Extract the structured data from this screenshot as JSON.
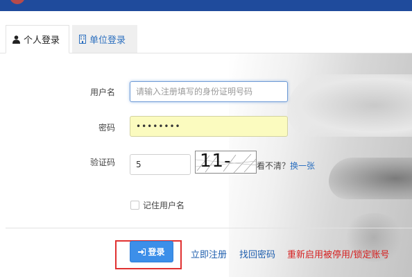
{
  "tabs": {
    "personal_label": "个人登录",
    "unit_label": "单位登录"
  },
  "form": {
    "username_label": "用户名",
    "username_placeholder": "请输入注册填写的身份证明号码",
    "password_label": "密码",
    "password_value": "••••••••",
    "captcha_label": "验证码",
    "captcha_value": "5",
    "captcha_image_text": "11-6=",
    "captcha_hint": "看不清？",
    "captcha_refresh": "换一张",
    "remember_label": "记住用户名"
  },
  "actions": {
    "login_label": "登录",
    "register_label": "立即注册",
    "find_password_label": "找回密码",
    "reenable_label": "重新启用被停用/锁定账号"
  },
  "colors": {
    "topbar": "#1f4b9c",
    "link": "#1f5fae",
    "danger_link": "#d62020",
    "primary_button": "#3c8fe9",
    "highlight_box": "#e03030"
  },
  "icons": {
    "personal_tab": "user-icon",
    "unit_tab": "building-icon",
    "login_button": "sign-in-icon"
  }
}
